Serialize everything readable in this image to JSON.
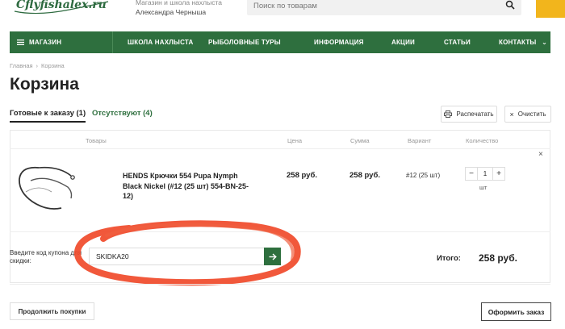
{
  "header": {
    "logo_text": "Cflyfishalex.ru",
    "tagline_line1": "Магазин и школа нахлыста",
    "tagline_line2": "Александра Чернышa",
    "search_placeholder": "Поиск по товарам"
  },
  "nav": {
    "shop": "Магазин",
    "items": [
      "Школа нахлыста",
      "Рыболовные туры",
      "Информация",
      "Акции",
      "Статьи",
      "Контакты"
    ]
  },
  "breadcrumb": {
    "home": "Главная",
    "sep": "›",
    "current": "Корзина"
  },
  "page_title": "Корзина",
  "tabs": {
    "ready": "Готовые к заказу (1)",
    "absent": "Отсутствуют (4)"
  },
  "actions": {
    "print": "Распечатать",
    "clear": "Очистить"
  },
  "table": {
    "headers": {
      "goods": "Товары",
      "price": "Цена",
      "sum": "Сумма",
      "variant": "Вариант",
      "qty": "Количество"
    }
  },
  "item": {
    "name": "HENDS Крючки 554 Pupa Nymph Black Nickel (#12 (25 шт) 554-BN-25-12)",
    "price": "258 руб.",
    "sum": "258 руб.",
    "variant": "#12 (25 шт)",
    "qty": "1",
    "unit": "шт",
    "minus": "−",
    "plus": "+",
    "remove": "×"
  },
  "coupon": {
    "label": "Введите код купона для скидки:",
    "value": "SKIDKA20"
  },
  "total": {
    "label": "Итого:",
    "value": "258 руб."
  },
  "buttons": {
    "continue": "Продолжить покупки",
    "order": "Оформить заказ"
  },
  "colors": {
    "brand_green": "#2e6f3e",
    "annotation_red": "#f04a2a",
    "badge_yellow": "#f2b51c"
  }
}
